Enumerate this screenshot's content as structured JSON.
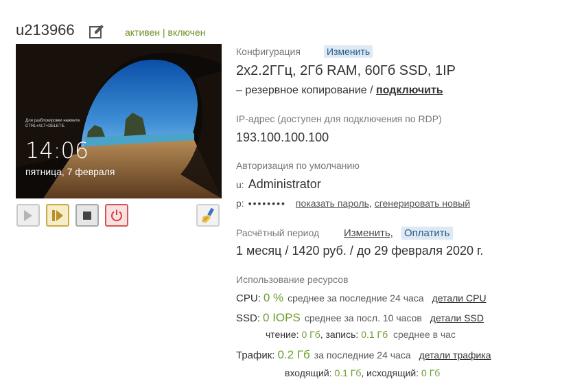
{
  "server": {
    "name": "u213966",
    "status_active": "активен",
    "status_separator": "|",
    "status_on": "включен"
  },
  "screen": {
    "hint": "Для разблокировки нажмите CTRL+ALT+DELETE.",
    "time": "14:06",
    "date": "пятница, 7 февраля"
  },
  "controls": {
    "icons": [
      "play-icon",
      "resume-icon",
      "stop-icon",
      "power-icon",
      "broom-icon"
    ]
  },
  "config": {
    "label": "Конфигурация",
    "change": "Изменить",
    "value": "2x2.2ГГц, 2Гб RAM, 60Гб SSD, 1IP",
    "backup_text": "– резервное копирование / ",
    "backup_link": "подключить"
  },
  "ip": {
    "label": "IP-адрес (доступен для подключения по RDP)",
    "value": "193.100.100.100"
  },
  "auth": {
    "label": "Авторизация по умолчанию",
    "user_prefix": "u:",
    "user": "Administrator",
    "pass_prefix": "p:",
    "pass_mask": "••••••••",
    "show_password": "показать пароль",
    "comma": ",",
    "generate_new": "сгенерировать новый"
  },
  "billing": {
    "label": "Расчётный период",
    "change": "Изменить,",
    "pay": "Оплатить",
    "value": "1 месяц / 1420 руб. / до 29 февраля 2020 г."
  },
  "resources": {
    "label": "Использование ресурсов",
    "cpu": {
      "key": "CPU:",
      "value": "0 %",
      "desc": "среднее за последние 24 часа",
      "link": "детали CPU"
    },
    "ssd": {
      "key": "SSD:",
      "value": "0 IOPS",
      "desc": "среднее за посл. 10 часов",
      "link": "детали SSD",
      "sub_read_label": "чтение:",
      "sub_read": "0 Гб",
      "sub_write_label": ", запись:",
      "sub_write": "0.1 Гб",
      "sub_desc": "среднее в час"
    },
    "traffic": {
      "key": "Трафик:",
      "value": "0.2 Гб",
      "desc": "за последние 24 часа",
      "link": "детали трафика",
      "sub_in_label": "входящий:",
      "sub_in": "0.1 Гб",
      "sub_out_label": ", исходящий:",
      "sub_out": "0 Гб"
    }
  },
  "colors": {
    "status_green": "#6b8e23",
    "value_green": "#6b9e2f",
    "chip_bg": "#dde9f3",
    "power_red": "#d45555",
    "resume_gold": "#c9a94a"
  }
}
